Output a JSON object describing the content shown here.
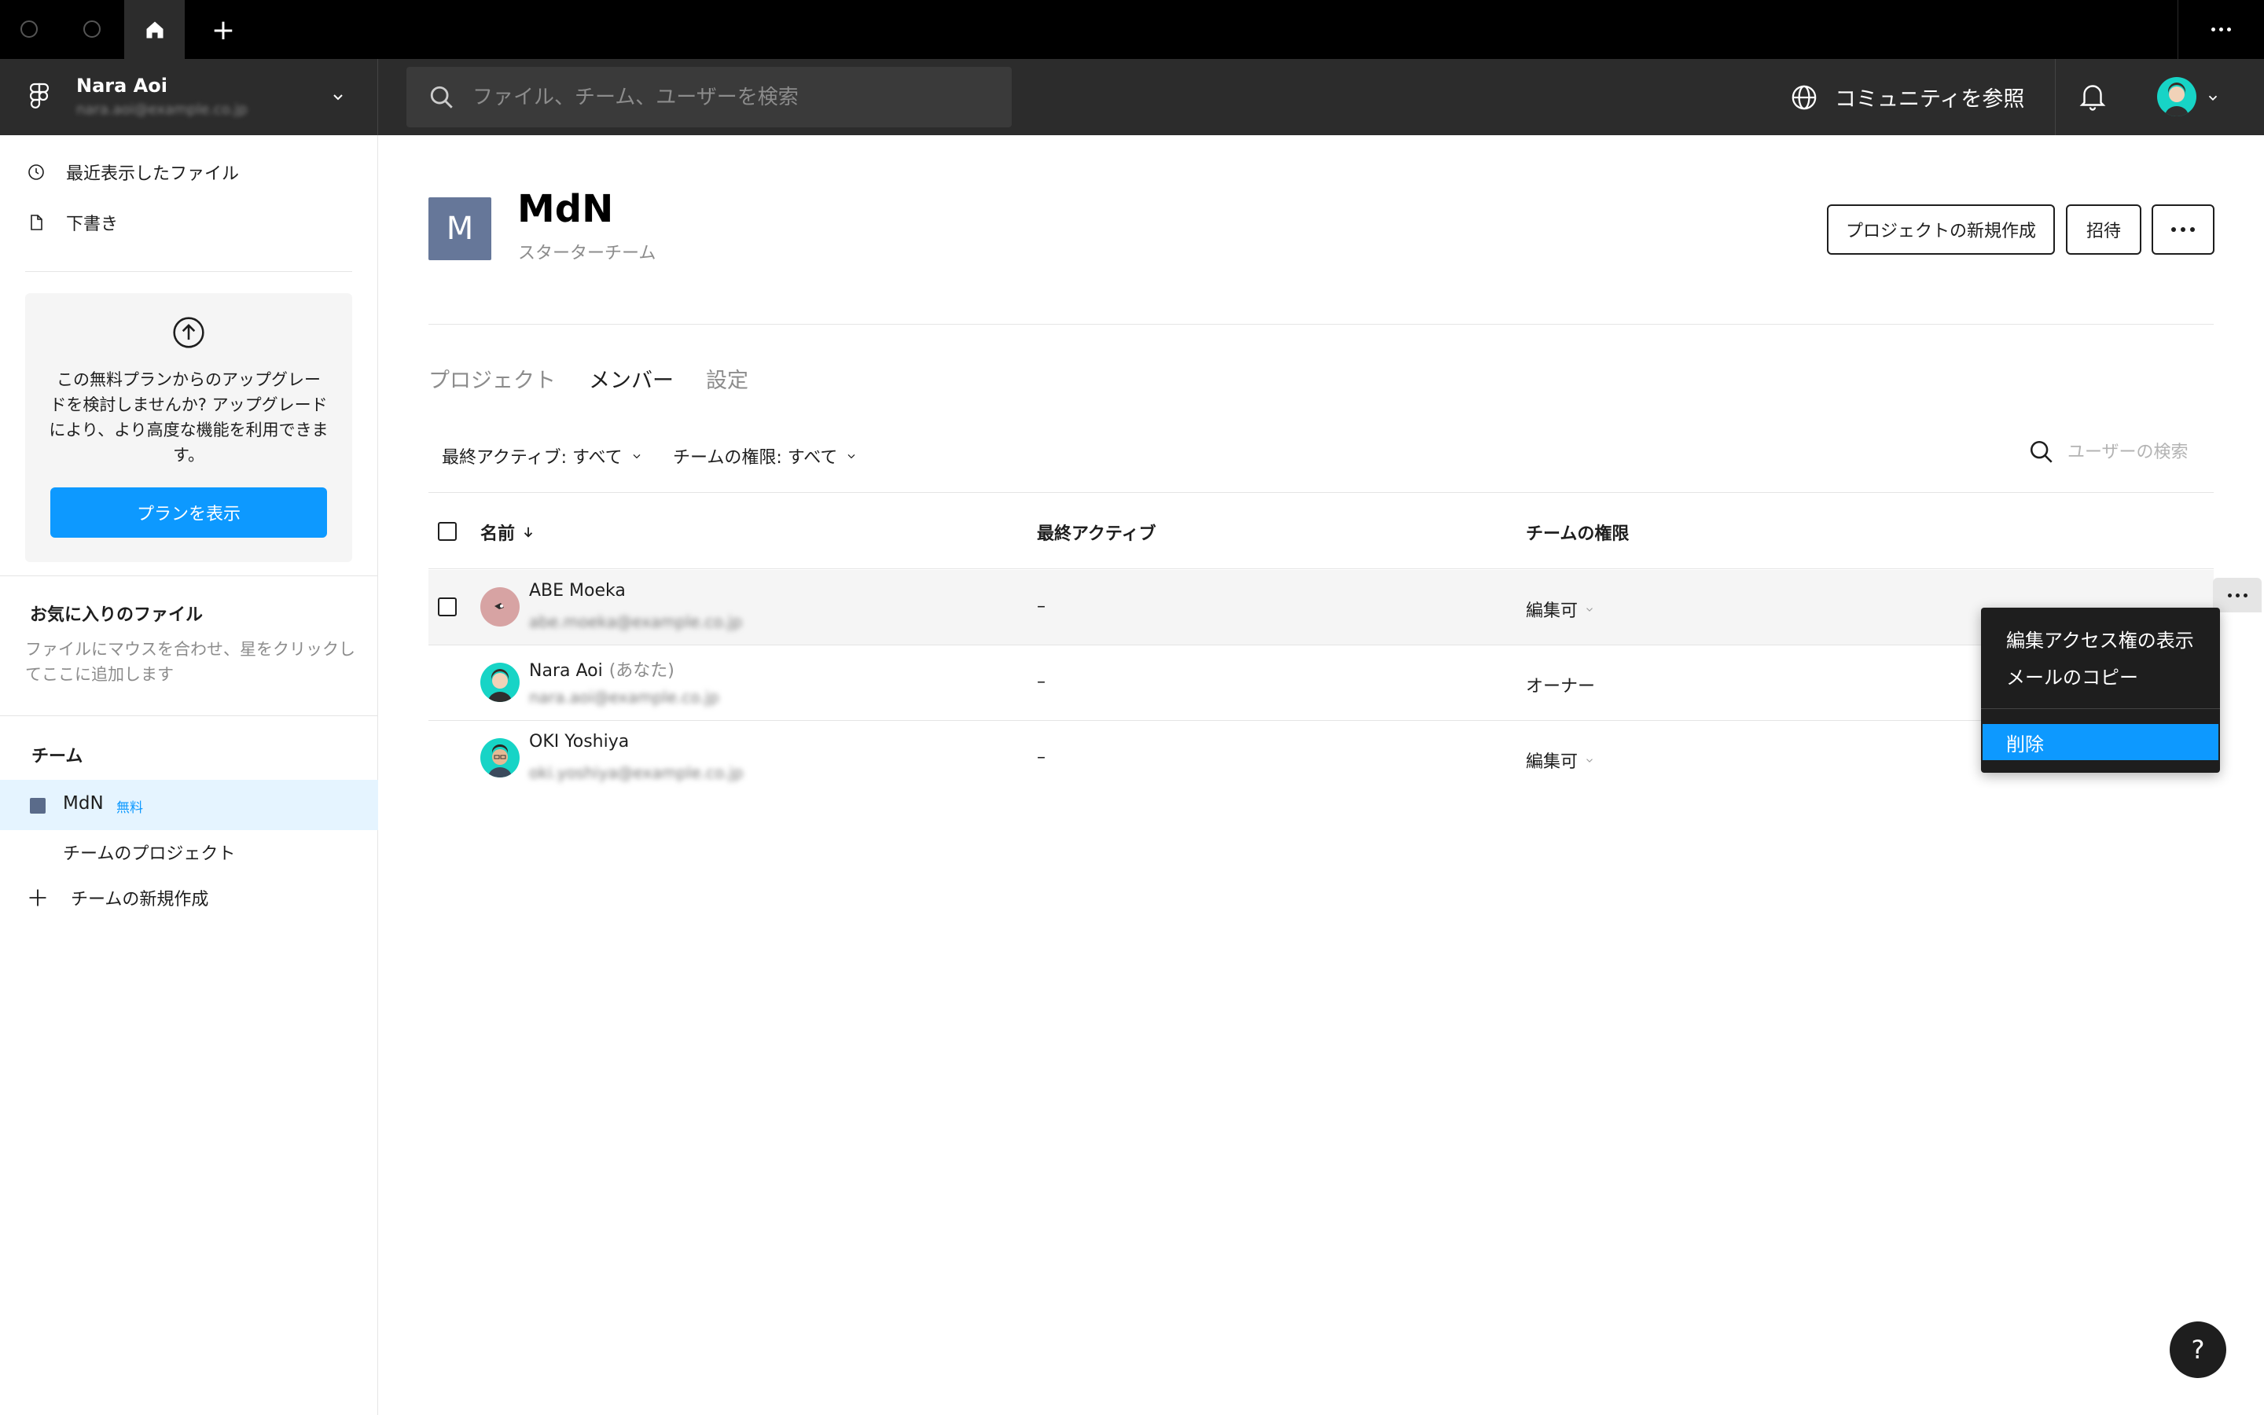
{
  "window": {
    "plus_label": "+"
  },
  "header": {
    "user_name": "Nara Aoi",
    "user_email": "nara.aoi@example.co.jp",
    "search_placeholder": "ファイル、チーム、ユーザーを検索",
    "community_label": "コミュニティを参照"
  },
  "sidebar": {
    "recent": "最近表示したファイル",
    "drafts": "下書き",
    "upgrade_text": "この無料プランからのアップグレードを検討しませんか? アップグレードにより、より高度な機能を利用できます。",
    "plan_button": "プランを表示",
    "favorites_title": "お気に入りのファイル",
    "favorites_desc": "ファイルにマウスを合わせ、星をクリックしてここに追加します",
    "team_title": "チーム",
    "team_name": "MdN",
    "team_badge": "無料",
    "team_projects": "チームのプロジェクト",
    "new_team": "チームの新規作成"
  },
  "main": {
    "team_initial": "M",
    "title": "MdN",
    "subtitle": "スターターチーム",
    "new_project_btn": "プロジェクトの新規作成",
    "invite_btn": "招待",
    "tabs": [
      "プロジェクト",
      "メンバー",
      "設定"
    ],
    "filter_last_active": "最終アクティブ: すべて",
    "filter_role": "チームの権限: すべて",
    "user_search_placeholder": "ユーザーの検索",
    "columns": {
      "name": "名前",
      "last_active": "最終アクティブ",
      "role": "チームの権限"
    },
    "members": [
      {
        "name": "ABE Moeka",
        "you": "",
        "email": "abe.moeka@example.co.jp",
        "last_active": "–",
        "role": "編集可"
      },
      {
        "name": "Nara Aoi",
        "you": "(あなた)",
        "email": "nara.aoi@example.co.jp",
        "last_active": "–",
        "role": "オーナー"
      },
      {
        "name": "OKI Yoshiya",
        "you": "",
        "email": "oki.yoshiya@example.co.jp",
        "last_active": "–",
        "role": "編集可"
      }
    ]
  },
  "context_menu": {
    "view_edit_access": "編集アクセス権の表示",
    "copy_email": "メールのコピー",
    "remove": "削除"
  },
  "help": {
    "label": "?"
  },
  "colors": {
    "accent": "#0d99ff",
    "topbar": "#000000",
    "appbar": "#2c2c2c",
    "team_color": "#667799"
  }
}
